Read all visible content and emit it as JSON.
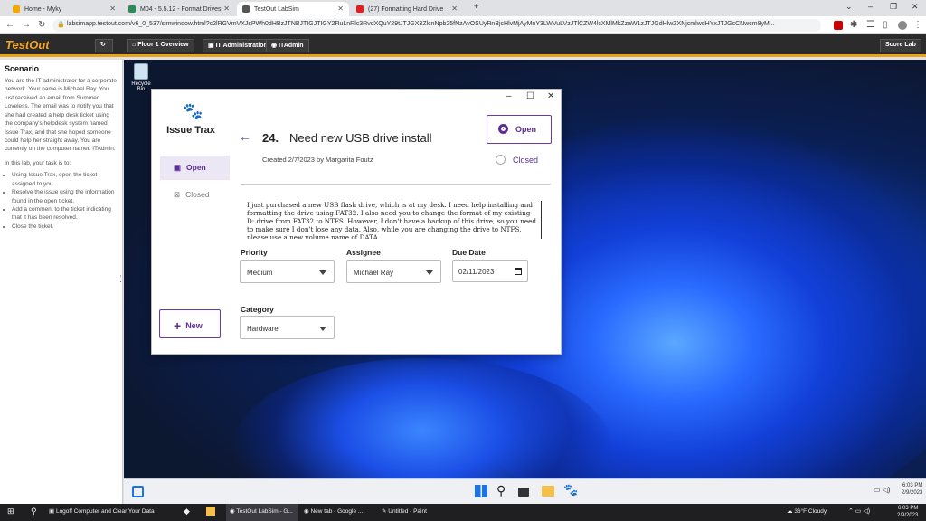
{
  "browser": {
    "tabs": [
      {
        "label": "Home - Myky",
        "color": "#f2a900"
      },
      {
        "label": "M04 - 5.5.12 - Format Drives",
        "color": "#2e8b57"
      },
      {
        "label": "TestOut LabSim",
        "color": "#555555",
        "active": true
      },
      {
        "label": "(27) Formatting Hard Drive",
        "color": "#e02020"
      }
    ],
    "url": "labsimapp.testout.com/v6_0_537/simwindow.html?c2lRGVmVXJsPWh0dHBzJTNBJTIGJTIGY2RuLnRlc3RvdXQuY29tJTJGX3ZlcnNpb25fNzAyOSUyRnBjcHlvMjAyMnY3LWVuLVzJTlCZW4lcXMlMkZzaW1zJTJGdHlwZXNjcmlwdHYxJTJGcCNwcm8yM..."
  },
  "testout": {
    "logo": "TestOut",
    "buttons": [
      "Floor 1 Overview",
      "IT Administration",
      "ITAdmin"
    ],
    "score_label": "Score Lab"
  },
  "scenario": {
    "title": "Scenario",
    "intro": "You are the IT administrator for a corporate network. Your name is Michael Ray. You just received an email from Summer Loveless. The email was to notify you that she had created a help desk ticket using the company's helpdesk system named Issue Trax, and that she hoped someone could help her straight away. You are currently on the computer named ITAdmin.",
    "task_lead": "In this lab, your task is to:",
    "tasks": [
      "Using Issue Trax, open the ticket assigned to you.",
      "Resolve the issue using the information found in the open ticket.",
      "Add a comment to the ticket indicating that it has been resolved.",
      "Close the ticket."
    ]
  },
  "desktop": {
    "recycle_bin": "Recycle Bin"
  },
  "issuetrax": {
    "app_title": "Issue Trax",
    "nav_open": "Open",
    "nav_closed": "Closed",
    "new_button": "New",
    "ticket": {
      "number": "24.",
      "title": "Need new USB drive installed",
      "created": "Created 2/7/2023 by Margarita Foutz",
      "status_open": "Open",
      "status_closed": "Closed",
      "description": "I just purchased a new USB flash drive, which is at my desk. I need help installing and formatting the drive using FAT32.  I also need you to change the format of my existing D: drive from FAT32 to NTFS. However, I don't have a backup of this drive, so you need to make sure I don't lose any data. Also, while you are changing the drive to NTFS, please use a new volume name of DATA.",
      "priority_label": "Priority",
      "priority": "Medium",
      "assignee_label": "Assignee",
      "assignee": "Michael Ray",
      "due_label": "Due Date",
      "due": "02/11/2023",
      "category_label": "Category",
      "category": "Hardware"
    }
  },
  "taskbar": {
    "logoff": "Logoff Computer and Clear Your Data",
    "items": [
      "TestOut LabSim - G...",
      "New tab - Google ...",
      "Untitled - Paint"
    ],
    "weather": "36°F  Cloudy",
    "vm_time": "6:03 PM",
    "vm_date": "2/9/2023",
    "host_time": "6:03 PM",
    "host_date": "2/9/2023"
  }
}
